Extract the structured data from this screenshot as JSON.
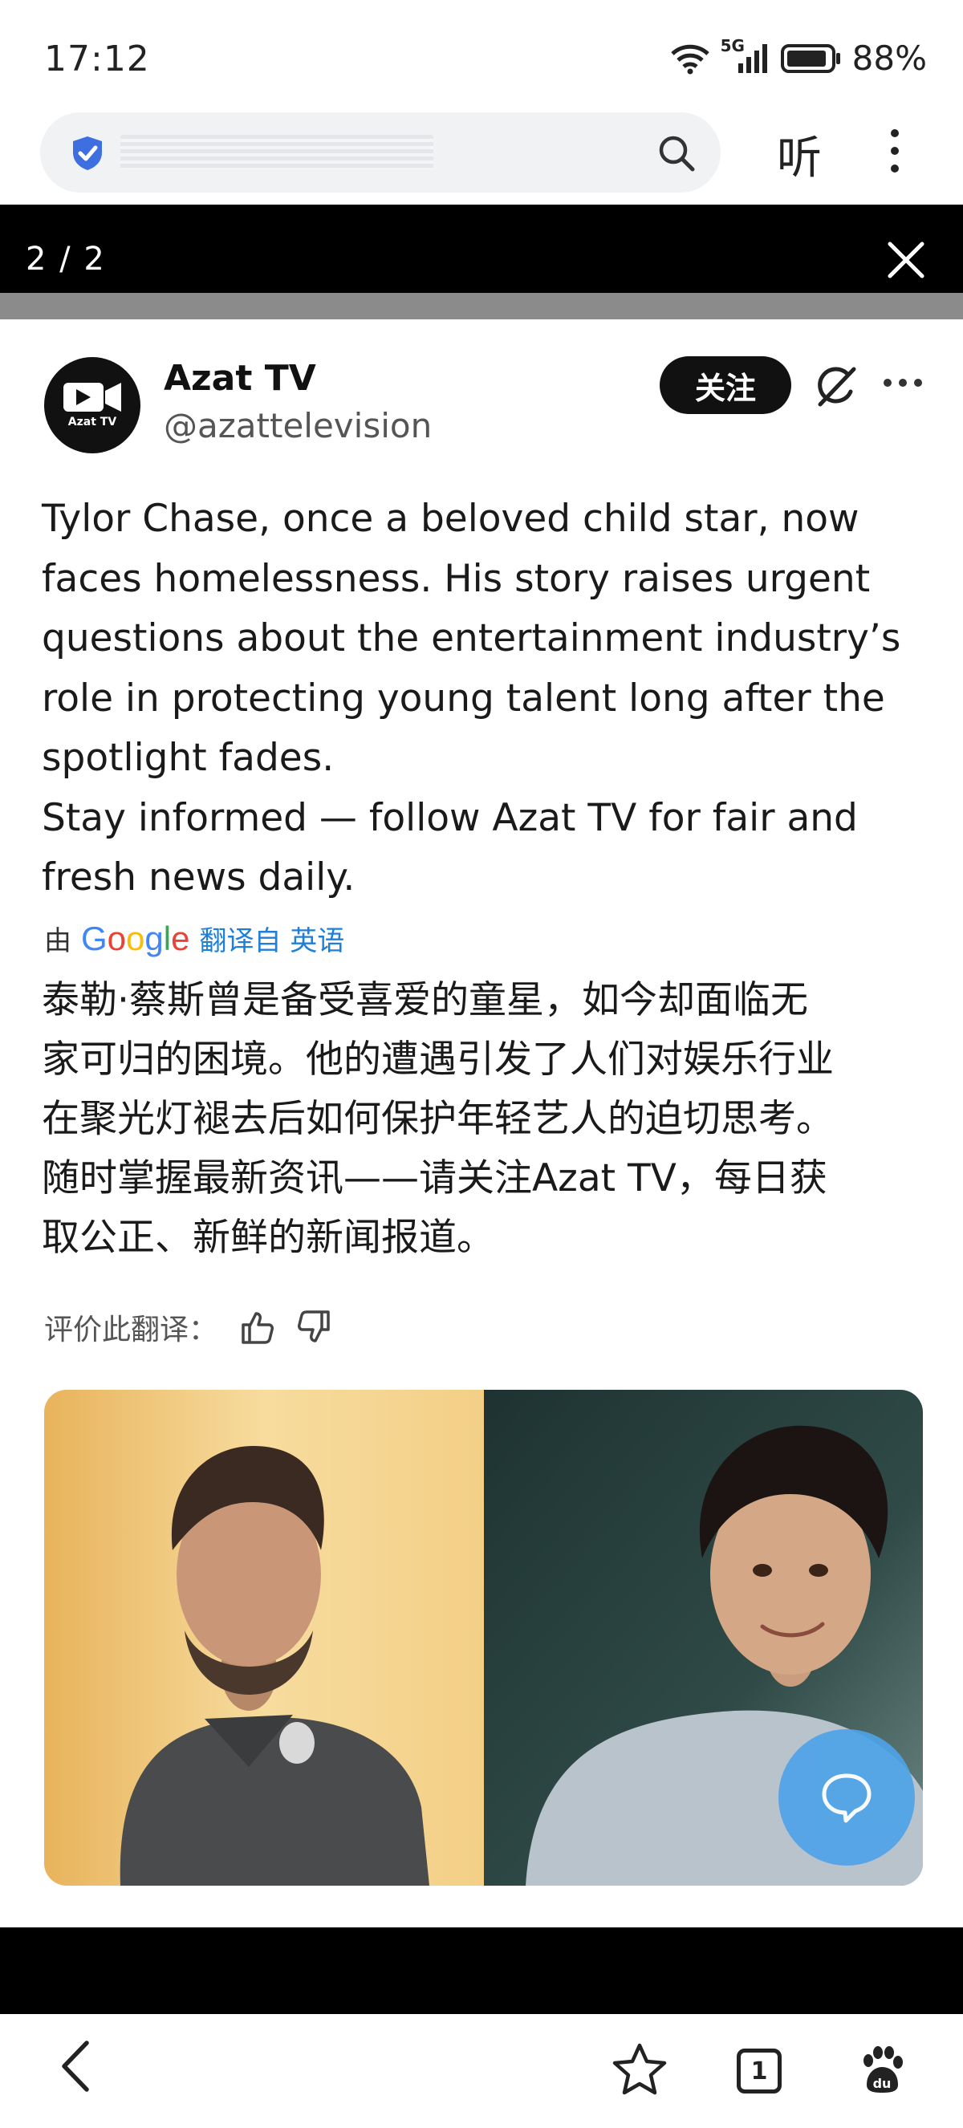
{
  "status_bar": {
    "time": "17:12",
    "network": "5G",
    "battery": "88%"
  },
  "browser": {
    "listen_label": "听"
  },
  "viewer": {
    "page_counter": "2 / 2"
  },
  "tweet": {
    "avatar_label": "Azat TV",
    "author_name": "Azat TV",
    "author_handle": "@azattelevision",
    "follow_label": "关注",
    "text": "Tylor Chase, once a beloved child star, now\nfaces homelessness. His story raises urgent\nquestions about the entertainment industry’s\nrole in protecting young talent long after the\nspotlight fades.\nStay informed — follow Azat TV for fair and\nfresh news daily.",
    "translated_by_prefix": "由",
    "translated_by_brand": "Google",
    "translated_from": "翻译自 英语",
    "translation": "泰勒·蔡斯曾是备受喜爱的童星，如今却面临无\n家可归的困境。他的遭遇引发了人们对娱乐行业\n在聚光灯褪去后如何保护年轻艺人的迫切思考。\n随时掌握最新资讯——请关注Azat TV，每日获\n取公正、新鲜的新闻报道。",
    "rate_label": "评价此翻译："
  },
  "colors": {
    "accent_blue": "#1d7fd8",
    "shield_blue": "#3d6fe0",
    "fab_blue": "#4ea3e8"
  },
  "bottom_nav": {
    "tab_count": "1"
  }
}
